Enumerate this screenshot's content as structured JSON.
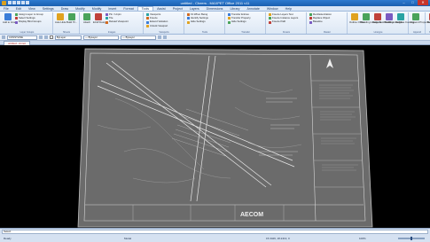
{
  "window": {
    "title": "untitled - Cheers - MAXPET Office 2011 v11",
    "minimize": "–",
    "maximize": "□",
    "close": "✕"
  },
  "menu_tabs": [
    "File",
    "Edit",
    "View",
    "Settings",
    "Draw",
    "Modify",
    "Modify",
    "Insert",
    "Format",
    "Tools",
    "Assist",
    "Project",
    "Layers",
    "Dimensions",
    "Library",
    "Annotate",
    "Window",
    "Help"
  ],
  "active_tab_index": 9,
  "ribbon": {
    "groups": [
      {
        "big": [
          "Add to Group"
        ],
        "small": [
          "Assign Layer to Group",
          "Select Settings",
          "Display Bind Groups"
        ],
        "label": "Layer Groups"
      },
      {
        "big": [
          "Auto Hide",
          "Build Til..."
        ],
        "small": [],
        "label": "Sheets"
      },
      {
        "big": [
          "Attach",
          "ECW Design"
        ],
        "small": [
          "Pin / Unpin",
          "Tile",
          "Reload Viewpoint"
        ],
        "label": "Images"
      },
      {
        "big": [],
        "small": [
          "Viewports",
          "Freeze",
          "Extend Variation",
          "Unlock Viewport"
        ],
        "label": "Viewports"
      },
      {
        "big": [],
        "small": [
          "Fit When Being",
          "Identify Settings",
          "Hide Settings"
        ],
        "label": "Tools"
      },
      {
        "big": [],
        "small": [
          "Transfer Entries",
          "Transfer Property",
          "Hide Settings"
        ],
        "label": "Transfer"
      },
      {
        "big": [],
        "small": [
          "Freeze Layers Text",
          "Freeze Instance Layers",
          "Freeze Path"
        ],
        "label": "Freeze"
      },
      {
        "big": [],
        "small": [
          "Re-Rasterization",
          "Replace Object",
          "Baseline"
        ],
        "label": "Raster"
      },
      {
        "big": [
          "Outline Offset",
          "Reading Linetypes",
          "Make Best Multiline",
          "Reading Linetype",
          "Multiline Cooking"
        ],
        "small": [],
        "label": "Linetype"
      },
      {
        "big": [
          "Append Properties"
        ],
        "small": [],
        "label": "Append"
      },
      {
        "big": [
          "Bearings Doc Out"
        ],
        "small": [],
        "label": "Bearings"
      }
    ]
  },
  "properties_bar": {
    "layer": "CONSTLINE",
    "color": "ByLayer",
    "linetype": "— ByLayer",
    "lineweight": "— ByLayer"
  },
  "document_tab": "untitled - Annot",
  "drawing": {
    "logo": "AECOM"
  },
  "status": {
    "command_prompt": "Select",
    "ready": "Ready",
    "model": "Model",
    "coords": "15.3429, 18.2413, 0",
    "zoom_label": "100%"
  },
  "colors": {
    "titlebar": "#1a5fb0",
    "ribbon": "#dde8f5",
    "canvas": "#000000",
    "sheet": "#6b6b6b",
    "doc_tab_text": "#b8241c"
  }
}
